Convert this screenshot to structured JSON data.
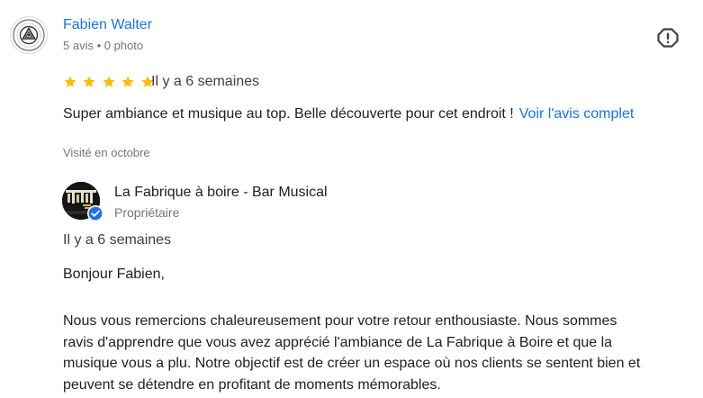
{
  "reviewer": {
    "name": "Fabien Walter",
    "meta": "5 avis • 0 photo",
    "avatar_icon": "emblem-avatar-icon"
  },
  "review": {
    "rating": 5,
    "max_rating": 5,
    "star_color": "#fbbc04",
    "date": "Il y a 6 semaines",
    "text": "Super ambiance et musique au top. Belle découverte pour cet endroit !",
    "read_more_label": "Voir l'avis complet",
    "visited": "Visité en octobre",
    "report_icon": "report-icon"
  },
  "owner_reply": {
    "name": "La Fabrique à boire - Bar Musical",
    "role": "Propriétaire",
    "verified_icon": "verified-check-icon",
    "badge_color": "#1a73e8",
    "date": "Il y a 6 semaines",
    "greeting": "Bonjour Fabien,",
    "body_lines": [
      "Nous vous remercions chaleureusement pour votre retour enthousiaste. Nous sommes",
      "ravis d'apprendre que vous avez apprécié l'ambiance de La Fabrique à Boire et que la",
      "musique vous a plu. Notre objectif est de créer un espace où nos clients se sentent bien et",
      "peuvent se détendre en profitant de moments mémorables."
    ]
  },
  "colors": {
    "link": "#1a73e8",
    "secondary_text": "#70757a",
    "primary_text": "#202124"
  }
}
